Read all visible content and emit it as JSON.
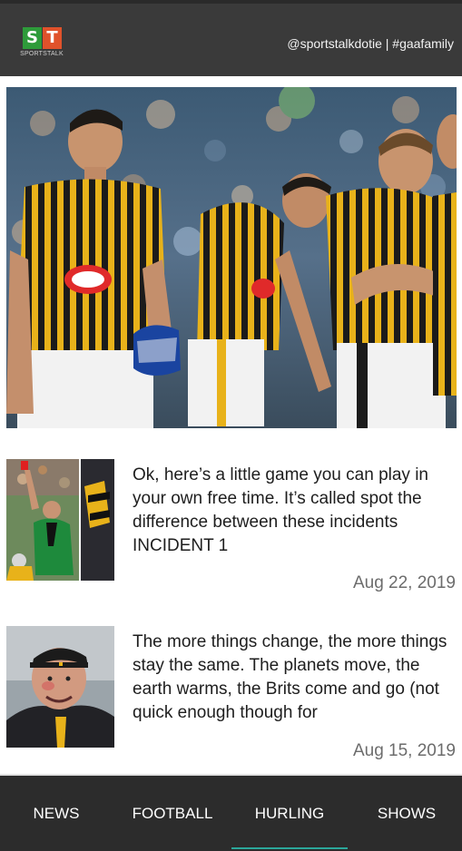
{
  "header": {
    "logo_letters": [
      "S",
      "T"
    ],
    "logo_subtitle": "SPORTSTALK",
    "handle": "@sportstalkdotie | #gaafamily"
  },
  "hero": {
    "image_icon": "hurling-team-photo",
    "shirt_logo": "Glanbia"
  },
  "articles": [
    {
      "snippet": "Ok, here’s a little game you can play in your own free time. It’s called spot the difference between these incidents INCIDENT 1",
      "date": "Aug 22, 2019",
      "thumbnail_icon": "referee-photo"
    },
    {
      "snippet": "The more things change, the more things stay the same. The planets move, the earth warms, the Brits come and go (not quick enough though for",
      "date": "Aug 15, 2019",
      "thumbnail_icon": "manager-portrait-photo"
    }
  ],
  "nav": {
    "items": [
      "NEWS",
      "FOOTBALL",
      "HURLING",
      "SHOWS"
    ],
    "active": "HURLING",
    "accent_color": "#2ba79a"
  }
}
